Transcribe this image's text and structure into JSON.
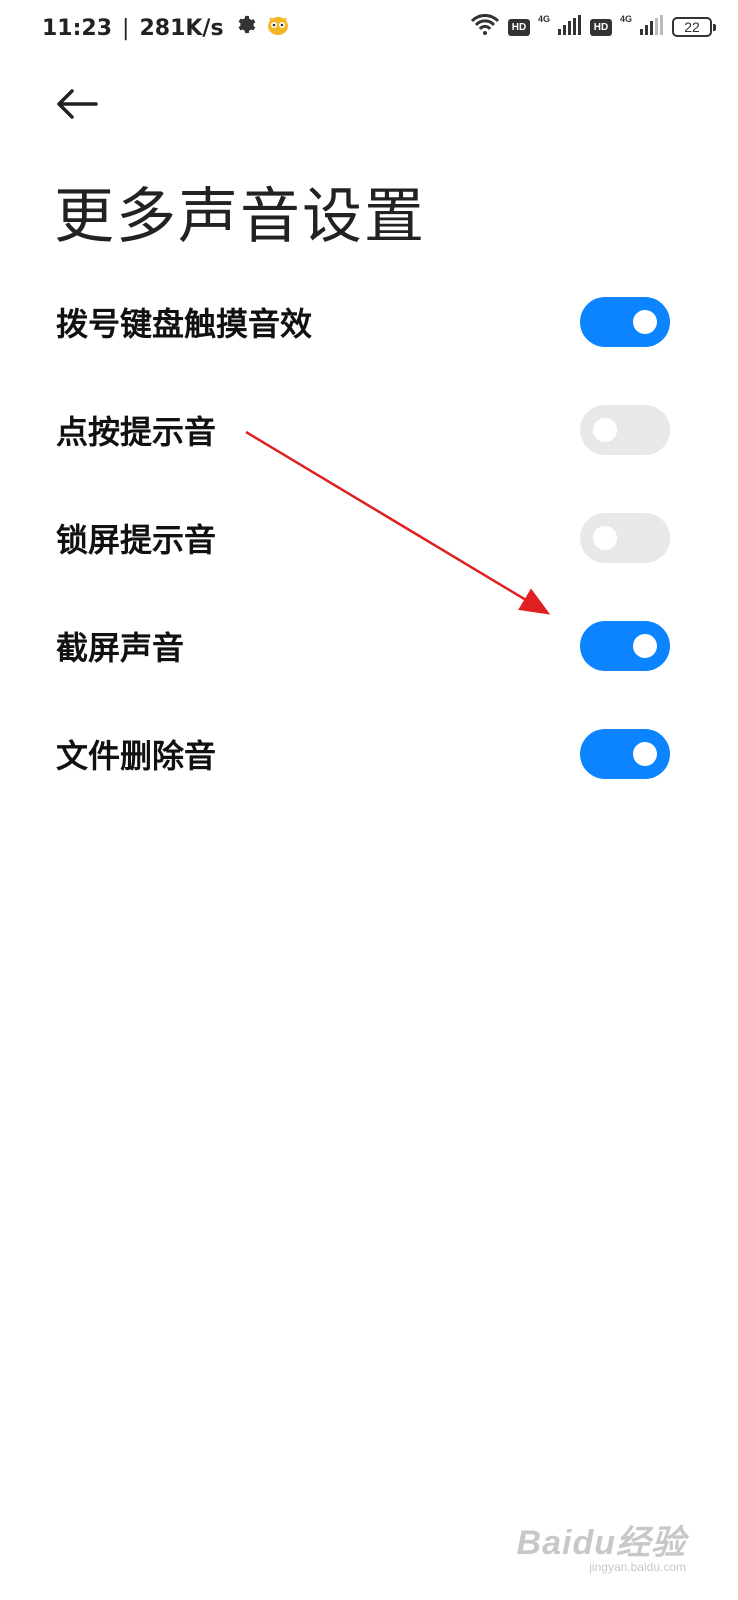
{
  "status_bar": {
    "time": "11:23",
    "separator": "|",
    "net_speed": "281K/s",
    "net_type_1": "4G",
    "net_type_2": "4G",
    "hd_label": "HD",
    "battery": "22"
  },
  "header": {
    "back_icon": "arrow-left-icon",
    "title": "更多声音设置"
  },
  "settings": [
    {
      "label": "拨号键盘触摸音效",
      "state": "on"
    },
    {
      "label": "点按提示音",
      "state": "off"
    },
    {
      "label": "锁屏提示音",
      "state": "off"
    },
    {
      "label": "截屏声音",
      "state": "on"
    },
    {
      "label": "文件删除音",
      "state": "on"
    }
  ],
  "colors": {
    "toggle_on": "#0d84ff",
    "toggle_off": "#e8e8e8",
    "annotation_arrow": "#e02020"
  },
  "watermark": {
    "main": "Baidu经验",
    "sub": "jingyan.baidu.com"
  }
}
